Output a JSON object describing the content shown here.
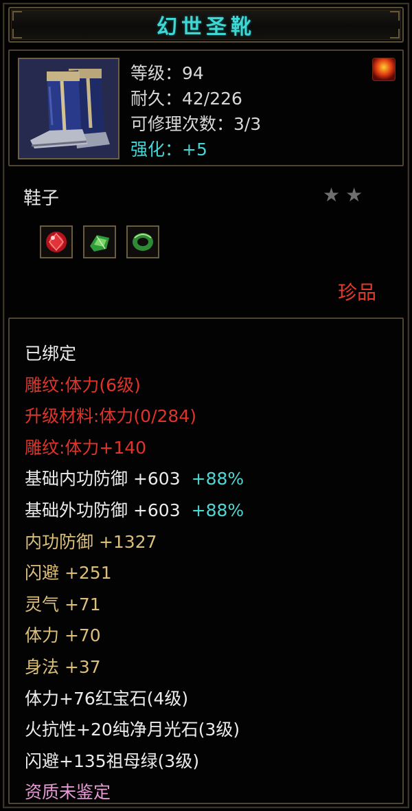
{
  "item": {
    "name": "幻世圣靴",
    "props": [
      {
        "text": "等级：94",
        "color": "white"
      },
      {
        "text": "耐久：42/226",
        "color": "white"
      },
      {
        "text": "可修理次数：3/3",
        "color": "white"
      },
      {
        "text": "强化：+5",
        "color": "cyan"
      }
    ],
    "type": "鞋子",
    "stars": [
      "★",
      "★"
    ],
    "gems": [
      "ruby-gem",
      "emerald-gem",
      "jade-ring-gem"
    ],
    "rarity": "珍品"
  },
  "stats": [
    {
      "text": "已绑定",
      "color": "white"
    },
    {
      "text": "雕纹:体力(6级)",
      "color": "red"
    },
    {
      "text": "升级材料:体力(0/284)",
      "color": "red"
    },
    {
      "text": "雕纹:体力+140",
      "color": "red"
    },
    {
      "text": "基础内功防御 +603",
      "pct": "+88%",
      "color": "white"
    },
    {
      "text": "基础外功防御 +603",
      "pct": "+88%",
      "color": "white"
    },
    {
      "text": "内功防御 +1327",
      "color": "tan"
    },
    {
      "text": "闪避 +251",
      "color": "tan"
    },
    {
      "text": "灵气 +71",
      "color": "tan"
    },
    {
      "text": "体力 +70",
      "color": "tan"
    },
    {
      "text": "身法 +37",
      "color": "tan"
    },
    {
      "text": "体力+76红宝石(4级)",
      "color": "white"
    },
    {
      "text": "火抗性+20纯净月光石(3级)",
      "color": "white"
    },
    {
      "text": "闪避+135祖母绿(3级)",
      "color": "white"
    },
    {
      "text": "资质未鉴定",
      "color": "pink"
    }
  ],
  "colors": {
    "title": "#3fd7d4",
    "cyan": "#44d5d4",
    "red": "#e0342b",
    "tan": "#dcbf7a",
    "pink": "#e69bd6",
    "rarity": "#e23a2c"
  }
}
